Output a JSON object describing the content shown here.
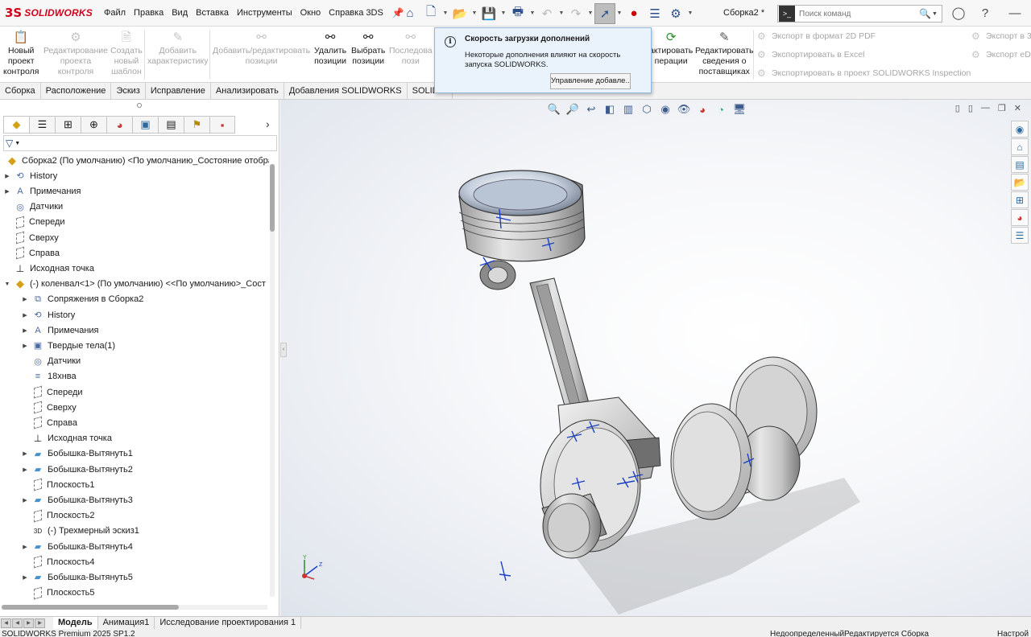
{
  "app": {
    "logo_text": "SOLIDWORKS",
    "document_title": "Сборка2 *"
  },
  "menu": [
    "Файл",
    "Правка",
    "Вид",
    "Вставка",
    "Инструменты",
    "Окно",
    "Справка 3DS"
  ],
  "search": {
    "placeholder": "Поиск команд"
  },
  "command_manager": {
    "buttons": [
      {
        "label_lines": [
          "Новый",
          "проект",
          "контроля"
        ],
        "enabled": true
      },
      {
        "label_lines": [
          "Редактирование",
          "проекта",
          "контроля"
        ],
        "enabled": false
      },
      {
        "label_lines": [
          "Создать",
          "новый",
          "шаблон"
        ],
        "enabled": false
      },
      {
        "label_lines": [
          "Добавить",
          "характеристику"
        ],
        "enabled": false
      },
      {
        "label_lines": [
          "Добавить/редактировать",
          "позиции"
        ],
        "enabled": false
      },
      {
        "label_lines": [
          "Удалить",
          "позиции"
        ],
        "enabled": true
      },
      {
        "label_lines": [
          "Выбрать",
          "позиции"
        ],
        "enabled": true
      },
      {
        "label_lines": [
          "Последова",
          "пози"
        ],
        "enabled": false
      },
      {
        "label_lines": [
          "актировать",
          "перации"
        ],
        "enabled": true
      },
      {
        "label_lines": [
          "Редактировать",
          "сведения о",
          "поставщиках"
        ],
        "enabled": true
      }
    ],
    "small_items": [
      "Экспорт в формат 2D PDF",
      "Экспортировать в Excel",
      "Экспортировать в проект SOLIDWORKS Inspection",
      "Экспорт в 3",
      "Экспорт eD"
    ]
  },
  "tabs": [
    "Сборка",
    "Расположение",
    "Эскиз",
    "Исправление",
    "Анализировать",
    "Добавления SOLIDWORKS",
    "SOLIDW"
  ],
  "notification": {
    "title": "Скорость загрузки дополнений",
    "body": "Некоторые дополнения влияют на скорость запуска SOLIDWORKS.",
    "button": "Управление добавле..."
  },
  "feature_tree": {
    "root": "Сборка2 (По умолчанию) <По умолчанию_Состояние отобра",
    "items": [
      {
        "label": "History",
        "level": 1,
        "expandable": true,
        "icon": "history-icon"
      },
      {
        "label": "Примечания",
        "level": 1,
        "expandable": true,
        "icon": "annotations-icon"
      },
      {
        "label": "Датчики",
        "level": 1,
        "expandable": false,
        "icon": "sensors-icon"
      },
      {
        "label": "Спереди",
        "level": 1,
        "expandable": false,
        "icon": "plane-icon"
      },
      {
        "label": "Сверху",
        "level": 1,
        "expandable": false,
        "icon": "plane-icon"
      },
      {
        "label": "Справа",
        "level": 1,
        "expandable": false,
        "icon": "plane-icon"
      },
      {
        "label": "Исходная точка",
        "level": 1,
        "expandable": false,
        "icon": "origin-icon"
      },
      {
        "label": "(-) коленвал<1> (По умолчанию) <<По умолчанию>_Сост",
        "level": 1,
        "expandable": true,
        "expanded": true,
        "icon": "part-icon"
      },
      {
        "label": "Сопряжения в Сборка2",
        "level": 2,
        "expandable": true,
        "icon": "mates-icon"
      },
      {
        "label": "History",
        "level": 2,
        "expandable": true,
        "icon": "history-icon"
      },
      {
        "label": "Примечания",
        "level": 2,
        "expandable": true,
        "icon": "annotations-icon"
      },
      {
        "label": "Твердые тела(1)",
        "level": 2,
        "expandable": true,
        "icon": "solid-bodies-icon"
      },
      {
        "label": "Датчики",
        "level": 2,
        "expandable": false,
        "icon": "sensors-icon"
      },
      {
        "label": "18хнва",
        "level": 2,
        "expandable": false,
        "icon": "material-icon"
      },
      {
        "label": "Спереди",
        "level": 2,
        "expandable": false,
        "icon": "plane-icon"
      },
      {
        "label": "Сверху",
        "level": 2,
        "expandable": false,
        "icon": "plane-icon"
      },
      {
        "label": "Справа",
        "level": 2,
        "expandable": false,
        "icon": "plane-icon"
      },
      {
        "label": "Исходная точка",
        "level": 2,
        "expandable": false,
        "icon": "origin-icon"
      },
      {
        "label": "Бобышка-Вытянуть1",
        "level": 2,
        "expandable": true,
        "icon": "extrude-icon"
      },
      {
        "label": "Бобышка-Вытянуть2",
        "level": 2,
        "expandable": true,
        "icon": "extrude-icon"
      },
      {
        "label": "Плоскость1",
        "level": 2,
        "expandable": false,
        "icon": "plane-icon"
      },
      {
        "label": "Бобышка-Вытянуть3",
        "level": 2,
        "expandable": true,
        "icon": "extrude-icon"
      },
      {
        "label": "Плоскость2",
        "level": 2,
        "expandable": false,
        "icon": "plane-icon"
      },
      {
        "label": "(-) Трехмерный эскиз1",
        "level": 2,
        "expandable": false,
        "icon": "sketch3d-icon"
      },
      {
        "label": "Бобышка-Вытянуть4",
        "level": 2,
        "expandable": true,
        "icon": "extrude-icon"
      },
      {
        "label": "Плоскость4",
        "level": 2,
        "expandable": false,
        "icon": "plane-icon"
      },
      {
        "label": "Бобышка-Вытянуть5",
        "level": 2,
        "expandable": true,
        "icon": "extrude-icon"
      },
      {
        "label": "Плоскость5",
        "level": 2,
        "expandable": false,
        "icon": "plane-icon"
      }
    ]
  },
  "bottom_tabs": [
    "Модель",
    "Анимация1",
    "Исследование проектирования 1"
  ],
  "status": {
    "product": "SOLIDWORKS Premium 2025 SP1.2",
    "state": "Недоопределенный",
    "editing": "Редактируется Сборка",
    "settings": "Настрой"
  },
  "triad_labels": {
    "x": "X",
    "y": "Y",
    "z": "Z"
  },
  "colors": {
    "brand": "#d0021b",
    "accent": "#2b4e8c",
    "notification_bg": "#eaf3fb"
  }
}
